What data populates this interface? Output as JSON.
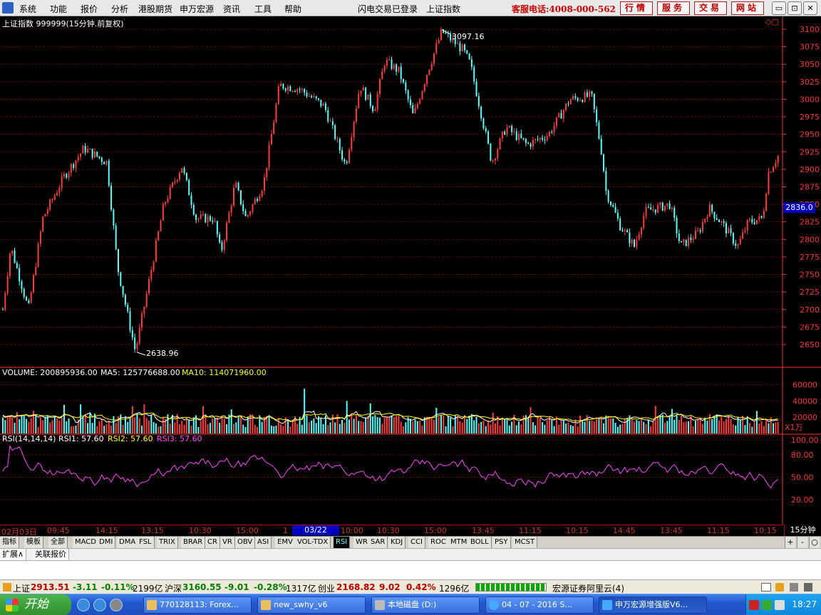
{
  "menubar": {
    "items": [
      "系统",
      "功能",
      "报价",
      "分析",
      "港股期货",
      "申万宏源",
      "资讯",
      "工具",
      "帮助"
    ],
    "login_status": "闪电交易已登录",
    "index_name": "上证指数",
    "hotline": "客服电话:4008-000-562",
    "right_buttons": [
      "行情",
      "服务",
      "交易",
      "网站"
    ],
    "window_buttons": [
      "▭",
      "⊡",
      "✕"
    ]
  },
  "chart": {
    "title": "上证指数 999999(15分钟.前复权)",
    "corner_icons": "◇▢",
    "price_label": "2836.0",
    "high_label": "3097.16",
    "low_label": "2638.96",
    "y_ticks": [
      "3100",
      "3075",
      "3050",
      "3025",
      "3000",
      "2975",
      "2950",
      "2925",
      "2900",
      "2875",
      "2850",
      "2825",
      "2800",
      "2775",
      "2750",
      "2725",
      "2700",
      "2675",
      "2650"
    ],
    "volume_header": {
      "prefix": "VOLUME: 200895936.00",
      "ma5": "MA5: 125776688.00",
      "ma10": "MA10: 114071960.00"
    },
    "volume_ticks": [
      "60000",
      "40000",
      "20000"
    ],
    "volume_unit": "X1万",
    "rsi_header": {
      "prefix": "RSI(14,14,14)",
      "rsi1": "RSI1: 57.60",
      "rsi2": "RSI2: 57.60",
      "rsi3": "RSI3: 57.60"
    },
    "rsi_ticks": [
      "100.00",
      "80.00",
      "50.00",
      "20.00"
    ],
    "colors": {
      "up": "#ff3c3c",
      "down": "#54ffff",
      "ma5": "#ffffff",
      "ma10": "#ffff00",
      "rsi": "#ff40ff",
      "grid": "#7a0000",
      "axis": "#ff3030"
    }
  },
  "chart_data": {
    "type": "candlestick",
    "title": "上证指数 999999(15分钟.前复权)",
    "ylim": [
      2630,
      3110
    ],
    "key_points": [
      {
        "x": "02月03日",
        "y": 2700
      },
      {
        "x": "09:45",
        "y": 2790
      },
      {
        "x": "14:15",
        "y": 2930
      },
      {
        "x": "13:15",
        "y": 2640
      },
      {
        "x": "10:30",
        "y": 2905
      },
      {
        "x": "15:00",
        "y": 2780
      },
      {
        "x": "03/22 13:30",
        "y": 3025
      },
      {
        "x": "10:30",
        "y": 3060
      },
      {
        "x": "15:00",
        "y": 3097.16
      },
      {
        "x": "13:45",
        "y": 3050
      },
      {
        "x": "11:15",
        "y": 2960
      },
      {
        "x": "10:15",
        "y": 3000
      },
      {
        "x": "14:45",
        "y": 2840
      },
      {
        "x": "13:45",
        "y": 2830
      },
      {
        "x": "11:15",
        "y": 2820
      },
      {
        "x": "10:15",
        "y": 2925
      }
    ],
    "high": 3097.16,
    "low": 2638.96,
    "last": 2836.0,
    "volume": {
      "ylim": [
        0,
        70000
      ],
      "unit": "X1万",
      "ma5": 125776688.0,
      "ma10": 114071960.0
    },
    "rsi": {
      "ylim": [
        0,
        100
      ],
      "rsi1": 57.6,
      "rsi2": 57.6,
      "rsi3": 57.6
    }
  },
  "timeaxis": {
    "labels": [
      "02月03日",
      "09:45",
      "14:15",
      "13:15",
      "10:30",
      "15:00",
      "1",
      "10:00",
      "10:30",
      "15:00",
      "13:45",
      "11:15",
      "10:15",
      "14:45",
      "13:45",
      "11:15",
      "10:15"
    ],
    "cursor_label": "03/22 13:30",
    "period": "15分钟"
  },
  "indicators": {
    "tabs": [
      "指标",
      "模板",
      "全部",
      "MACD",
      "DMI",
      "DMA",
      "FSL",
      "TRIX",
      "BRAR",
      "CR",
      "VR",
      "OBV",
      "ASI",
      "EMV",
      "VOL-TDX",
      "RSI",
      "WR",
      "SAR",
      "KDJ",
      "CCI",
      "ROC",
      "MTM",
      "BOLL",
      "PSY",
      "MCST"
    ],
    "selected": "RSI",
    "side": [
      "+",
      "-",
      "○"
    ]
  },
  "extension": {
    "tabs": [
      "扩展∧",
      "关联报价"
    ]
  },
  "status": {
    "sh_name": "上证",
    "sh_val": "2913.51",
    "sh_chg": "-3.11",
    "sh_pct": "-0.11%",
    "sh_amt": "2199亿",
    "hs_name": "沪深",
    "hs_val": "3160.55",
    "hs_chg": "-9.01",
    "hs_pct": "-0.28%",
    "hs_amt": "1317亿",
    "cy_name": "创业",
    "cy_val": "2168.82",
    "cy_chg": "9.02",
    "cy_pct": "0.42%",
    "cy_amt": "1296亿",
    "server": "宏源证券阿里云(4)"
  },
  "taskbar": {
    "start": "开始",
    "tasks": [
      "770128113: Forex...",
      "new_swhy_v6",
      "本地磁盘 (D:)",
      "04 - 07 - 2016 S...",
      "申万宏源增强版V6..."
    ],
    "clock": "18:27"
  }
}
